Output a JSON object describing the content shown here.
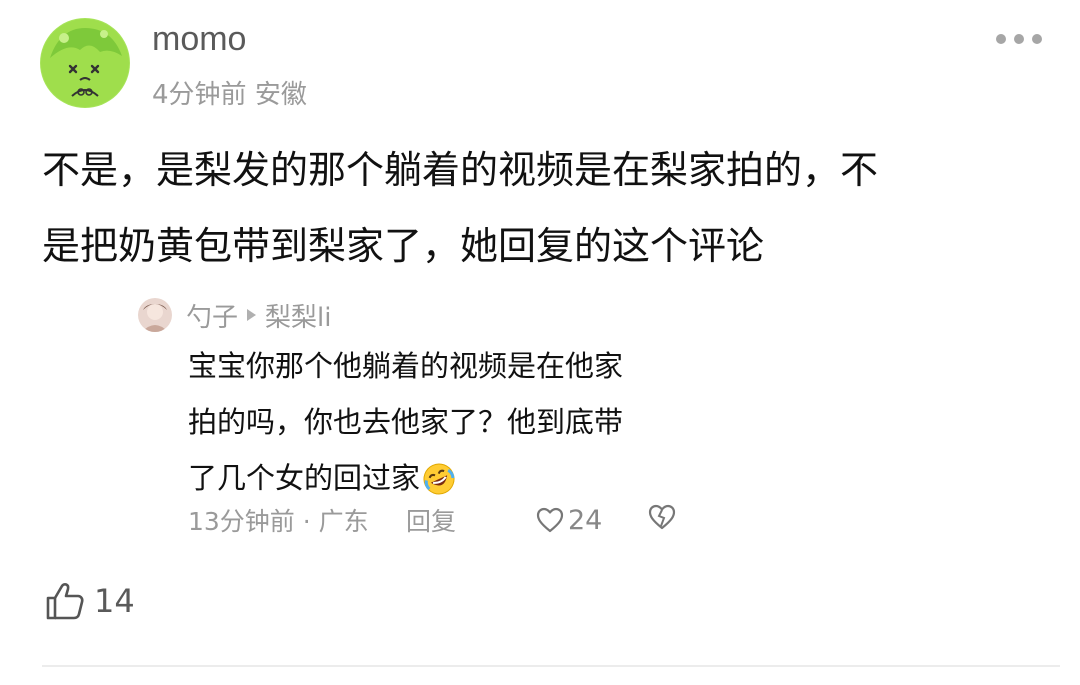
{
  "post": {
    "username": "momo",
    "time": "4分钟前",
    "location": "安徽",
    "body_line1": "不是，是梨发的那个躺着的视频是在梨家拍的，不",
    "body_line2": "是把奶黄包带到梨家了，她回复的这个评论",
    "like_count": "14",
    "icons": {
      "more": "more-icon",
      "like": "thumbs-up-icon"
    }
  },
  "quoted_comment": {
    "author": "勺子",
    "reply_to": "梨梨li",
    "line1": "宝宝你那个他躺着的视频是在他家",
    "line2": "拍的吗，你也去他家了？他到底带",
    "line3": "了几个女的回过家",
    "emoji": "rolling-on-floor-laughing-emoji",
    "time_location": "13分钟前 · 广东",
    "reply_label": "回复",
    "like_count": "24",
    "icons": {
      "like": "heart-icon",
      "dislike": "broken-heart-icon"
    }
  },
  "colors": {
    "text": "#111111",
    "secondary": "#9a9a9a",
    "avatar_green": "#a4e04a"
  }
}
